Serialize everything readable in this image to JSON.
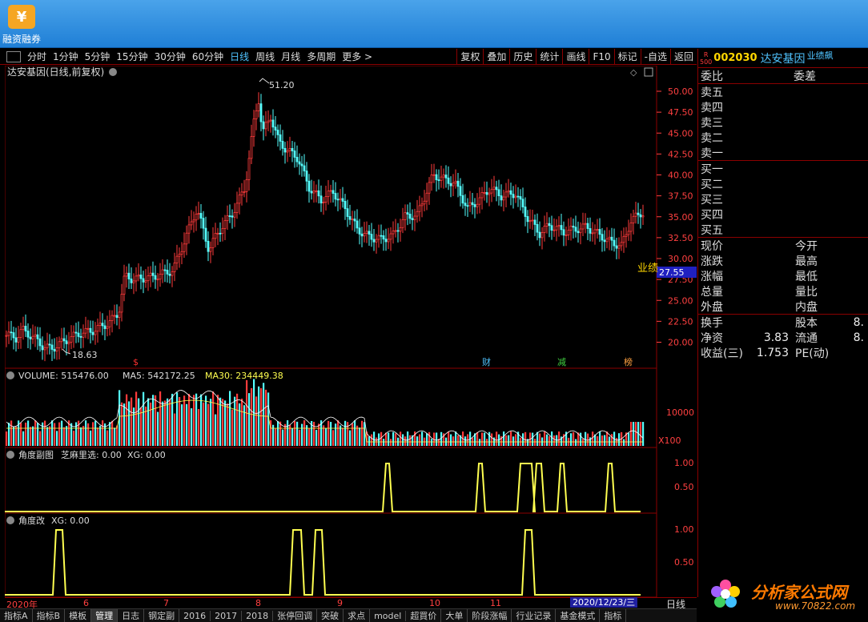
{
  "app": {
    "label": "融资融券",
    "logo_glyph": "¥"
  },
  "toolbar": {
    "periods": [
      "分时",
      "1分钟",
      "5分钟",
      "15分钟",
      "30分钟",
      "60分钟",
      "日线",
      "周线",
      "月线",
      "多周期",
      "更多 >"
    ],
    "active_period": "日线",
    "actions": [
      "复权",
      "叠加",
      "历史",
      "统计",
      "画线",
      "F10",
      "标记",
      "-自选",
      "返回"
    ]
  },
  "main_chart": {
    "title": "达安基因(日线,前复权)",
    "high_label": "51.20",
    "low_label": "18.63",
    "price_axis": [
      "50.00",
      "47.50",
      "45.00",
      "42.50",
      "40.00",
      "37.50",
      "35.00",
      "32.50",
      "30.00",
      "27.50",
      "25.00",
      "22.50",
      "20.00"
    ],
    "current_price_tag": "27.55",
    "side_label": "业绩",
    "event_markers": [
      {
        "text": "$",
        "color": "#ff3030"
      },
      {
        "text": "财",
        "color": "#4fc3ff"
      },
      {
        "text": "减",
        "color": "#40d040"
      },
      {
        "text": "榜",
        "color": "#ffa040"
      }
    ]
  },
  "volume_panel": {
    "label": "VOLUME: 515476.00",
    "ma5": "MA5: 542172.25",
    "ma30": "MA30: 234449.38",
    "axis_label": "10000",
    "unit_label": "X100"
  },
  "indicator1": {
    "name": "角度副图",
    "params": "芝麻里选: 0.00",
    "xg": "XG: 0.00",
    "axis": [
      "1.00",
      "0.50"
    ]
  },
  "indicator2": {
    "name": "角度改",
    "xg": "XG: 0.00",
    "axis": [
      "1.00",
      "0.50"
    ]
  },
  "date_axis": {
    "labels": [
      "2020年",
      "6",
      "7",
      "8",
      "9",
      "10",
      "11"
    ],
    "cursor_date": "2020/12/23/三",
    "period": "日线"
  },
  "bottom_tabs": [
    "指标A",
    "指标B",
    "模板",
    "管理",
    "日志",
    "钢定副",
    "2016",
    "2017",
    "2018",
    "张停回调",
    "突破",
    "求点",
    "model",
    "超買价",
    "大单",
    "阶段涨幅",
    "行业记录",
    "基金模式",
    "指标"
  ],
  "right_panel": {
    "code": "002030",
    "name": "达安基因",
    "tag": "业绩飙",
    "badge_top": "R",
    "badge_bottom": "500",
    "header_row": [
      "委比",
      "委差"
    ],
    "sell_levels": [
      "卖五",
      "卖四",
      "卖三",
      "卖二",
      "卖一"
    ],
    "buy_levels": [
      "买一",
      "买二",
      "买三",
      "买四",
      "买五"
    ],
    "quote_rows": [
      {
        "k1": "现价",
        "v1": "",
        "k2": "今开",
        "v2": ""
      },
      {
        "k1": "涨跌",
        "v1": "",
        "k2": "最高",
        "v2": ""
      },
      {
        "k1": "涨幅",
        "v1": "",
        "k2": "最低",
        "v2": ""
      },
      {
        "k1": "总量",
        "v1": "",
        "k2": "量比",
        "v2": ""
      },
      {
        "k1": "外盘",
        "v1": "",
        "k2": "内盘",
        "v2": ""
      }
    ],
    "fund_rows": [
      {
        "k1": "换手",
        "v1": "",
        "k2": "股本",
        "v2": "8."
      },
      {
        "k1": "净资",
        "v1": "3.83",
        "k2": "流通",
        "v2": "8."
      },
      {
        "k1": "收益(三)",
        "v1": "1.753",
        "k2": "PE(动)",
        "v2": ""
      }
    ]
  },
  "watermark": {
    "title": "分析家公式网",
    "url": "www.70822.com"
  },
  "colors": {
    "up": "#ff3b3b",
    "down": "#54ffff",
    "grid": "#8b0000",
    "signal": "#ffff50"
  }
}
